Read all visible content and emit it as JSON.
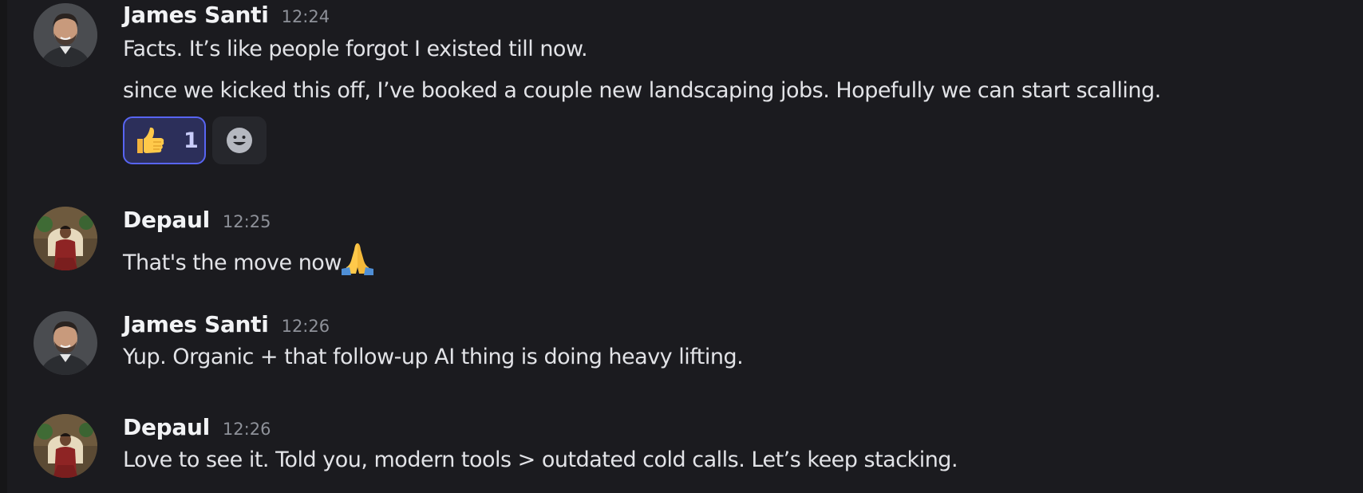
{
  "messages": [
    {
      "author": "James Santi",
      "time": "12:24",
      "lines": [
        "Facts. It’s like people forgot I existed till now.",
        "since we kicked this off, I’ve booked a couple new landscaping jobs. Hopefully we can start scalling."
      ],
      "reactions": [
        {
          "emoji": "thumbs-up-emoji",
          "count": "1",
          "active": true
        }
      ]
    },
    {
      "author": "Depaul",
      "time": "12:25",
      "lines": [
        "That's the move now"
      ],
      "trailing_emoji": "folded-hands-emoji"
    },
    {
      "author": "James Santi",
      "time": "12:26",
      "lines": [
        "Yup. Organic + that follow-up AI thing is doing heavy lifting."
      ]
    },
    {
      "author": "Depaul",
      "time": "12:26",
      "lines": [
        "Love to see it. Told you, modern tools > outdated cold calls. Let’s keep stacking."
      ]
    }
  ],
  "icons": {
    "add_reaction": "smiley-face-icon"
  },
  "colors": {
    "background": "#1b1b1f",
    "reaction_active_bg": "#2c2f5a",
    "reaction_active_border": "#5865f2",
    "timestamp": "#8e9199"
  }
}
